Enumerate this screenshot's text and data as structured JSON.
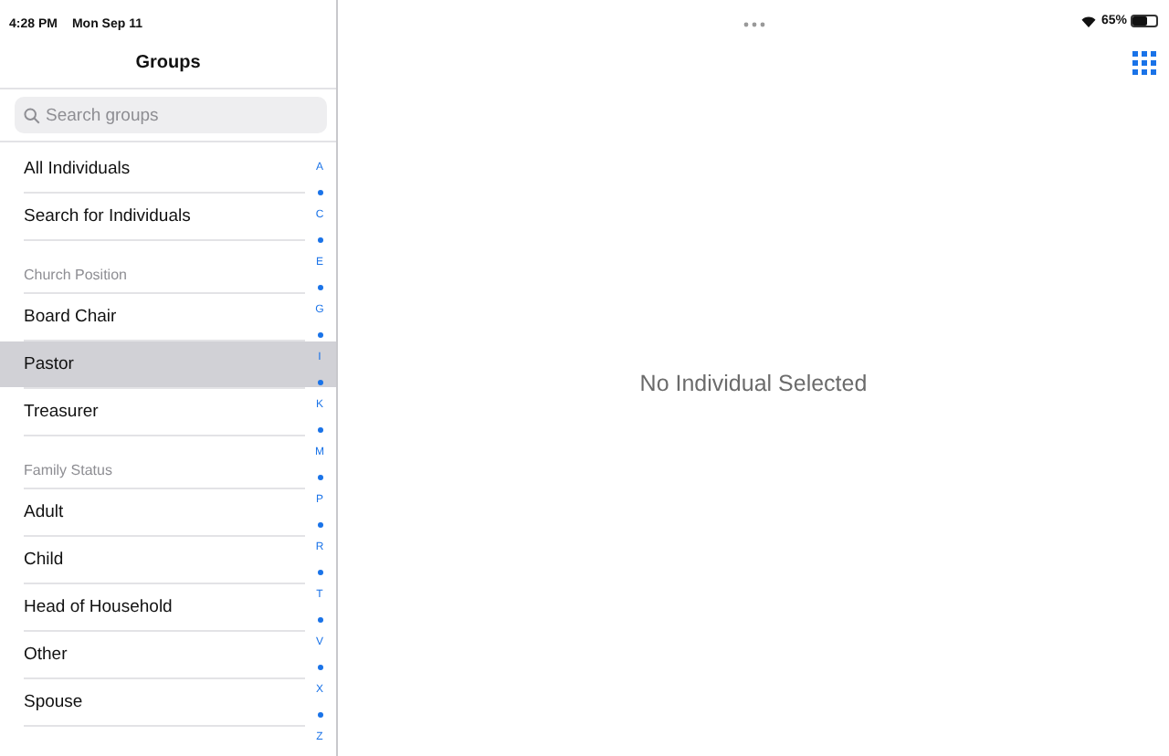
{
  "status_bar": {
    "time": "4:28 PM",
    "date": "Mon Sep 11",
    "battery_percent": "65%",
    "battery": {
      "level": 0.65
    }
  },
  "sidebar": {
    "title": "Groups",
    "search": {
      "placeholder": "Search groups"
    },
    "sections": [
      {
        "items": [
          {
            "label": "All Individuals",
            "selected": false
          },
          {
            "label": "Search for Individuals",
            "selected": false
          }
        ]
      },
      {
        "header": "Church Position",
        "items": [
          {
            "label": "Board Chair",
            "selected": false
          },
          {
            "label": "Pastor",
            "selected": true
          },
          {
            "label": "Treasurer",
            "selected": false
          }
        ]
      },
      {
        "header": "Family Status",
        "items": [
          {
            "label": "Adult",
            "selected": false
          },
          {
            "label": "Child",
            "selected": false
          },
          {
            "label": "Head of Household",
            "selected": false
          },
          {
            "label": "Other",
            "selected": false
          },
          {
            "label": "Spouse",
            "selected": false
          }
        ]
      }
    ],
    "index_letters": [
      "A",
      "C",
      "E",
      "G",
      "I",
      "K",
      "M",
      "P",
      "R",
      "T",
      "V",
      "X",
      "Z"
    ]
  },
  "detail": {
    "message": "No Individual Selected"
  }
}
